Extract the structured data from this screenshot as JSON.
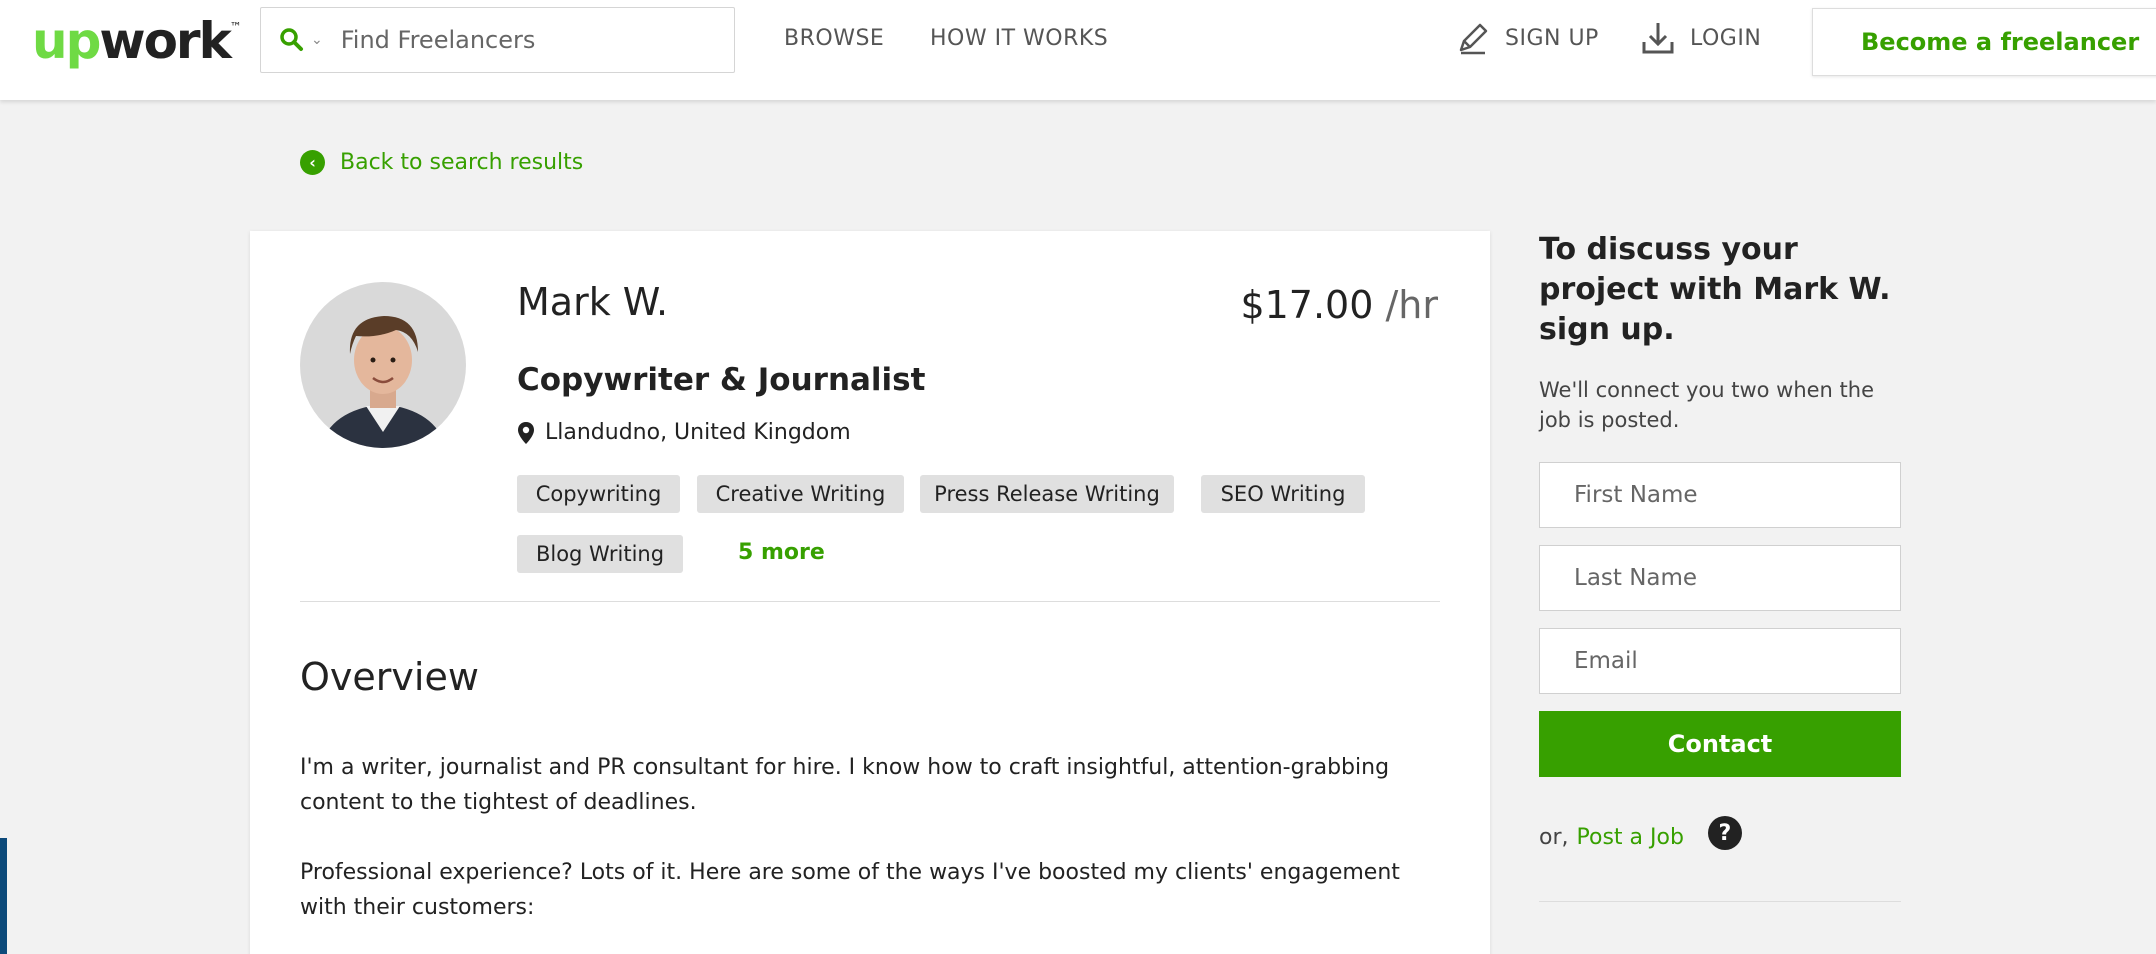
{
  "header": {
    "logo_accent": "up",
    "logo_rest": "work",
    "logo_tm": "™",
    "search_placeholder": "Find Freelancers",
    "nav": {
      "browse": "BROWSE",
      "how_it_works": "HOW IT WORKS",
      "sign_up": "SIGN UP",
      "login": "LOGIN"
    },
    "become_freelancer": "Become a freelancer"
  },
  "back_link": "Back to search results",
  "profile": {
    "name": "Mark W.",
    "rate_amount": "$17.00",
    "rate_unit": " /hr",
    "title": "Copywriter & Journalist",
    "location": "Llandudno, United Kingdom",
    "skills": [
      "Copywriting",
      "Creative Writing",
      "Press Release Writing",
      "SEO Writing",
      "Blog Writing"
    ],
    "more_skills": "5 more"
  },
  "overview": {
    "heading": "Overview",
    "paragraphs": [
      "I'm a writer, journalist and PR consultant for hire. I know how to craft insightful, attention-grabbing content to the tightest of deadlines.",
      "Professional experience? Lots of it. Here are some of the ways I've boosted my clients' engagement with their customers:"
    ]
  },
  "sidebar": {
    "heading": "To discuss your project with Mark W. sign up.",
    "subtext": "We'll connect you two when the job is posted.",
    "first_name_placeholder": "First Name",
    "last_name_placeholder": "Last Name",
    "email_placeholder": "Email",
    "contact_button": "Contact",
    "or_text": "or,",
    "post_job": "Post a Job",
    "help_symbol": "?"
  },
  "colors": {
    "brand_green": "#37a000",
    "logo_green": "#6fda44",
    "page_bg": "#f2f2f2"
  },
  "icons": [
    "search-icon",
    "chevron-down-icon",
    "pencil-icon",
    "download-icon",
    "back-chevron-icon",
    "location-pin-icon",
    "help-icon"
  ]
}
